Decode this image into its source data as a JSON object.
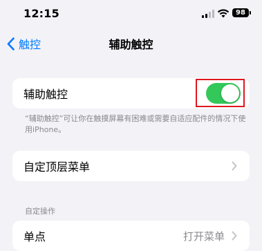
{
  "status_bar": {
    "time": "12:15",
    "battery": "98"
  },
  "nav": {
    "back_label": "触控",
    "title": "辅助触控"
  },
  "assistive_touch": {
    "label": "辅助触控",
    "enabled": true,
    "accent_color": "#34c759",
    "highlight_color": "#e0161e"
  },
  "description": "“辅助触控”可让你在触摸屏幕有困难或需要自适应配件的情况下使用iPhone。",
  "top_menu": {
    "label": "自定顶层菜单"
  },
  "custom_actions": {
    "header": "自定操作",
    "single_tap": {
      "label": "单点",
      "value": "打开菜单"
    }
  }
}
